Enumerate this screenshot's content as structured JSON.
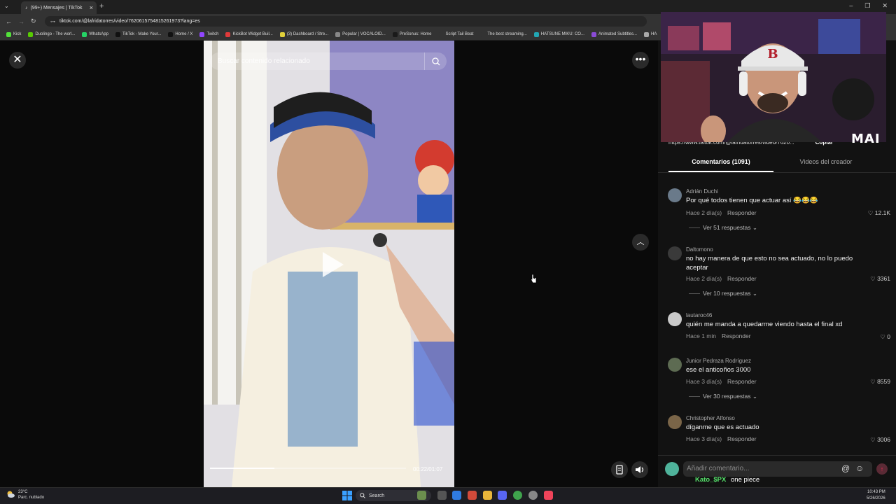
{
  "browser": {
    "tab_title": "(99+) Mensajes | TikTok",
    "url": "tiktok.com/@lafridatorres/video/7620615754815261973?lang=es",
    "bookmarks": [
      "Kick",
      "Duolingo - The worl...",
      "WhatsApp",
      "TikTok - Make Your...",
      "Home / X",
      "Twitch",
      "KickBot Widget Buil...",
      "(3) Dashboard / Stre...",
      "Popular | VOCALOID...",
      "PreSonus: Home",
      "Script Tail Beat",
      "The best streaming...",
      "HATSUNE MIKU: CO...",
      "Animated Subtitles...",
      "HA"
    ]
  },
  "video": {
    "search_placeholder": "Buscar contenido relacionado",
    "timecode": "00:22/01:07",
    "progress": 0.33
  },
  "panel": {
    "link": "https://www.tiktok.com/@lafridatorres/video/7620...",
    "copy_label": "Copiar",
    "tabs": [
      "Comentarios (1091)",
      "Videos del creador"
    ],
    "reply_label": "Responder",
    "comments": [
      {
        "user": "Adrián Duchi",
        "text": "Por qué todos tienen que actuar así 😂😂😂",
        "time": "Hace 2 día(s)",
        "likes": "12.1K",
        "replies": "Ver 51 respuestas",
        "avatar_color": "#6a7a8a"
      },
      {
        "user": "Daltomono",
        "text": "no hay manera de que esto no sea actuado, no lo puedo aceptar",
        "time": "Hace 2 día(s)",
        "likes": "3361",
        "replies": "Ver 10 respuestas",
        "avatar_color": "#3a3a3a"
      },
      {
        "user": "lautaroc46",
        "text": "quién me manda a quedarme viendo hasta el final xd",
        "time": "Hace 1 min",
        "likes": "0",
        "replies": "",
        "avatar_color": "#c9c9c9"
      },
      {
        "user": "Junior Pedraza Rodríguez",
        "text": "ese el anticoños 3000",
        "time": "Hace 3 día(s)",
        "likes": "8559",
        "replies": "Ver 30 respuestas",
        "avatar_color": "#5d6b52"
      },
      {
        "user": "Christopher Alfonso",
        "text": "díganme que es actuado",
        "time": "Hace 3 día(s)",
        "likes": "3006",
        "replies": "",
        "avatar_color": "#7a6548"
      }
    ],
    "comment_placeholder": "Añadir comentario...",
    "chat_user": "Kato_$PX",
    "chat_text": "one piece"
  },
  "webcam": {
    "brand": "MAI"
  },
  "taskbar": {
    "weather_temp": "23°C",
    "weather_desc": "Parc. nublado",
    "search_label": "Search",
    "time": "10:43 PM",
    "date": "5/26/2026"
  },
  "colors": {
    "accent": "#fe2c55",
    "chat_user": "#55e06a"
  }
}
